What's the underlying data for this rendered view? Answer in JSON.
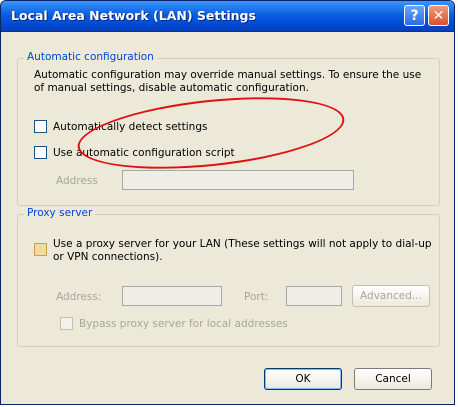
{
  "window": {
    "title": "Local Area Network (LAN) Settings",
    "help_glyph": "?",
    "close_glyph": "✕"
  },
  "auto_config": {
    "group_label": "Automatic configuration",
    "description": "Automatic configuration may override manual settings.  To ensure the use of manual settings, disable automatic configuration.",
    "detect_label": "Automatically detect settings",
    "detect_checked": false,
    "script_label": "Use automatic configuration script",
    "script_checked": false,
    "address_label": "Address",
    "address_value": ""
  },
  "proxy": {
    "group_label": "Proxy server",
    "use_proxy_label": "Use a proxy server for your LAN (These settings will not apply to dial-up or VPN connections).",
    "use_proxy_checked": false,
    "address_label": "Address:",
    "address_value": "",
    "port_label": "Port:",
    "port_value": "",
    "advanced_label": "Advanced...",
    "bypass_label": "Bypass proxy server for local addresses",
    "bypass_checked": false
  },
  "buttons": {
    "ok": "OK",
    "cancel": "Cancel"
  },
  "annotation": {
    "color": "#e01010"
  }
}
